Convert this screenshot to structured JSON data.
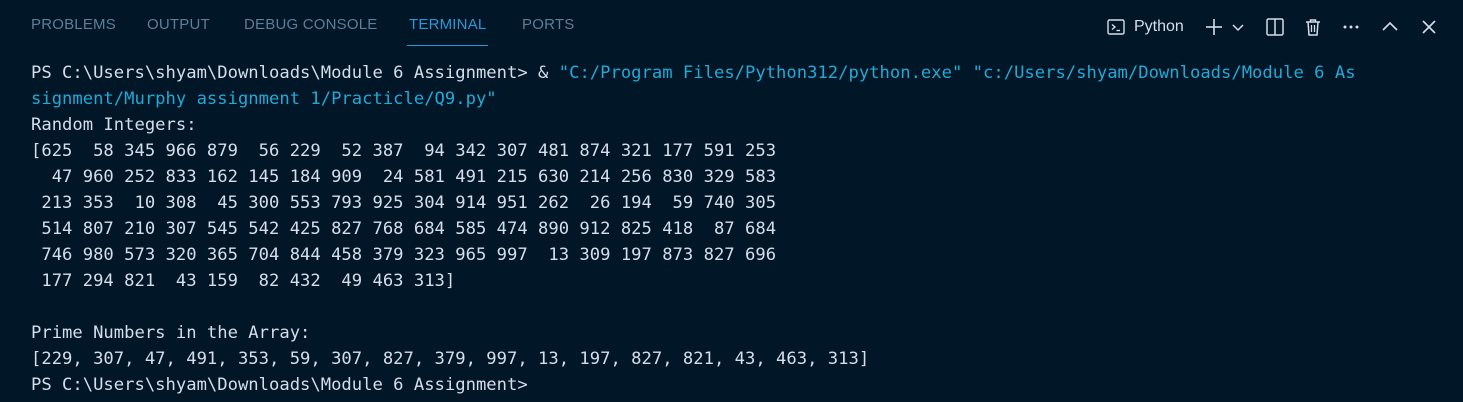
{
  "tabs": [
    {
      "label": "PROBLEMS",
      "active": false
    },
    {
      "label": "OUTPUT",
      "active": false
    },
    {
      "label": "DEBUG CONSOLE",
      "active": false
    },
    {
      "label": "TERMINAL",
      "active": true
    },
    {
      "label": "PORTS",
      "active": false
    }
  ],
  "toolbar": {
    "terminal_profile": "Python",
    "icons": [
      "terminal-icon",
      "plus-icon",
      "chevron-down-icon",
      "split-icon",
      "trash-icon",
      "more-icon",
      "chevron-up-icon",
      "close-icon"
    ]
  },
  "colors": {
    "background": "#011627",
    "text": "#d6deeb",
    "string": "#22aad6",
    "active_tab": "#2d97d6",
    "inactive_tab": "#5f7e97"
  },
  "terminal": {
    "command": {
      "prompt": "PS C:\\Users\\shyam\\Downloads\\Module 6 Assignment> & ",
      "exe_path": "\"C:/Program Files/Python312/python.exe\"",
      "script_path_part1": "\"c:/Users/shyam/Downloads/Module 6 As",
      "script_path_part2": "signment/Murphy assignment 1/Practicle/Q9.py\""
    },
    "random_header": "Random Integers:",
    "array_lines": [
      "[625  58 345 966 879  56 229  52 387  94 342 307 481 874 321 177 591 253",
      "  47 960 252 833 162 145 184 909  24 581 491 215 630 214 256 830 329 583",
      " 213 353  10 308  45 300 553 793 925 304 914 951 262  26 194  59 740 305",
      " 514 807 210 307 545 542 425 827 768 684 585 474 890 912 825 418  87 684",
      " 746 980 573 320 365 704 844 458 379 323 965 997  13 309 197 873 827 696",
      " 177 294 821  43 159  82 432  49 463 313]"
    ],
    "prime_header": "Prime Numbers in the Array:",
    "primes_line": "[229, 307, 47, 491, 353, 59, 307, 827, 379, 997, 13, 197, 827, 821, 43, 463, 313]",
    "final_prompt": "PS C:\\Users\\shyam\\Downloads\\Module 6 Assignment>"
  }
}
